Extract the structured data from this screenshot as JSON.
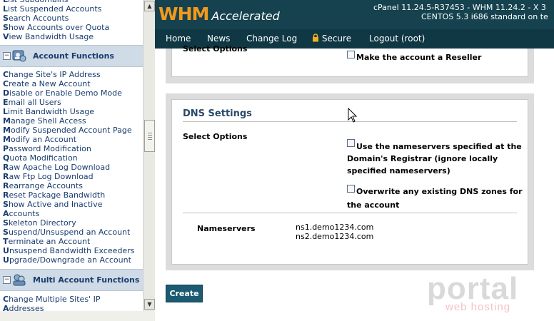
{
  "sidebar": {
    "top_items": [
      {
        "first": "L",
        "rest": "ist Subdomains"
      },
      {
        "first": "L",
        "rest": "ist Suspended Accounts"
      },
      {
        "first": "S",
        "rest": "earch Accounts"
      },
      {
        "first": "S",
        "rest": "how Accounts over Quota"
      },
      {
        "first": "V",
        "rest": "iew Bandwidth Usage"
      }
    ],
    "account_functions_header": "Account Functions",
    "account_items": [
      {
        "first": "C",
        "rest": "hange Site's IP Address"
      },
      {
        "first": "C",
        "rest": "reate a New Account"
      },
      {
        "first": "D",
        "rest": "isable or Enable Demo Mode"
      },
      {
        "first": "E",
        "rest": "mail all Users"
      },
      {
        "first": "L",
        "rest": "imit Bandwidth Usage"
      },
      {
        "first": "M",
        "rest": "anage Shell Access"
      },
      {
        "first": "M",
        "rest": "odify Suspended Account Page"
      },
      {
        "first": "M",
        "rest": "odify an Account"
      },
      {
        "first": "P",
        "rest": "assword Modification"
      },
      {
        "first": "Q",
        "rest": "uota Modification"
      },
      {
        "first": "R",
        "rest": "aw Apache Log Download"
      },
      {
        "first": "R",
        "rest": "aw Ftp Log Download"
      },
      {
        "first": "R",
        "rest": "earrange Accounts"
      },
      {
        "first": "R",
        "rest": "eset Package Bandwidth"
      },
      {
        "first": "S",
        "rest": "how Active and Inactive"
      },
      {
        "first": "A",
        "rest": "ccounts"
      },
      {
        "first": "S",
        "rest": "keleton Directory"
      },
      {
        "first": "S",
        "rest": "uspend/Unsuspend an Account"
      },
      {
        "first": "T",
        "rest": "erminate an Account"
      },
      {
        "first": "U",
        "rest": "nsuspend Bandwidth Exceeders"
      },
      {
        "first": "U",
        "rest": "pgrade/Downgrade an Account"
      }
    ],
    "multi_functions_header": "Multi Account Functions",
    "multi_items": [
      {
        "first": "C",
        "rest": "hange Multiple Sites' IP"
      },
      {
        "first": "A",
        "rest": "ddresses"
      }
    ]
  },
  "header": {
    "logo_whm": "WHM",
    "logo_accelerated": "Accelerated",
    "version_line1": "cPanel 11.24.5-R37453 - WHM 11.24.2 - X 3",
    "version_line2": "CENTOS 5.3 i686 standard on te"
  },
  "nav": {
    "home": "Home",
    "news": "News",
    "changelog": "Change Log",
    "secure": "Secure",
    "logout": "Logout (root)"
  },
  "reseller_panel": {
    "select_options_label": "Select Options",
    "reseller_checkbox_label": "Make the account a Reseller"
  },
  "dns_panel": {
    "title": "DNS Settings",
    "select_options_label": "Select Options",
    "option1_line1": "Use the nameservers specified at the",
    "option1_line2": "Domain's Registrar (ignore locally",
    "option1_line3": "specified nameservers)",
    "option2_line1": "Overwrite any existing DNS zones for",
    "option2_line2": "the account",
    "nameservers_label": "Nameservers",
    "ns1": "ns1.demo1234.com",
    "ns2": "ns2.demo1234.com"
  },
  "create_button": "Create",
  "watermark": {
    "brand": "portal",
    "tagline": "web hosting"
  }
}
